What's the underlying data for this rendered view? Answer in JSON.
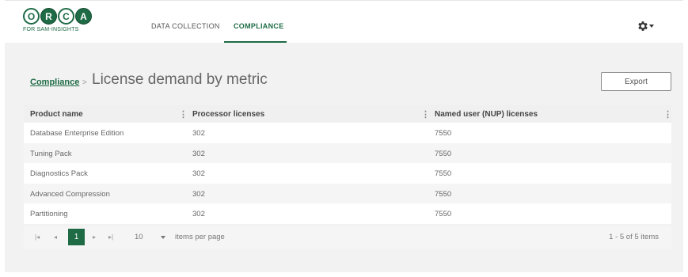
{
  "logo": {
    "letters": [
      "O",
      "R",
      "C",
      "A"
    ],
    "subtitle": "FOR SAM-INSIGHTS"
  },
  "nav": {
    "items": [
      {
        "label": "DATA COLLECTION"
      },
      {
        "label": "COMPLIANCE",
        "active": true
      }
    ]
  },
  "header": {
    "settings_icon": "gear-icon"
  },
  "breadcrumb": {
    "link": "Compliance",
    "separator": ">",
    "title": "License demand by metric"
  },
  "toolbar": {
    "export_label": "Export"
  },
  "grid": {
    "columns": [
      "Product name",
      "Processor licenses",
      "Named user (NUP) licenses"
    ],
    "rows": [
      [
        "Database Enterprise Edition",
        "302",
        "7550"
      ],
      [
        "Tuning Pack",
        "302",
        "7550"
      ],
      [
        "Diagnostics Pack",
        "302",
        "7550"
      ],
      [
        "Advanced Compression",
        "302",
        "7550"
      ],
      [
        "Partitioning",
        "302",
        "7550"
      ]
    ]
  },
  "pager": {
    "current_page": "1",
    "page_size": "10",
    "page_size_label": "items per page",
    "info": "1 - 5 of 5 items"
  },
  "colors": {
    "brand": "#1e6b45"
  }
}
